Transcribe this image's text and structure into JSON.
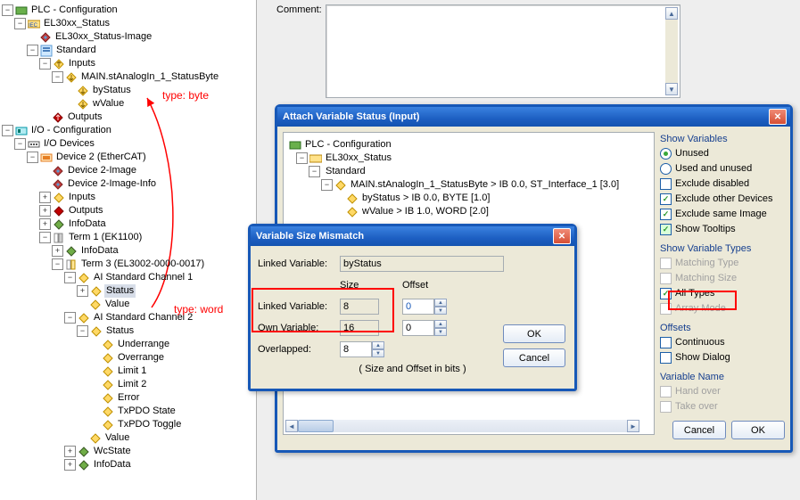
{
  "left_tree": {
    "plc_config": "PLC - Configuration",
    "el30xx_status": "EL30xx_Status",
    "el30xx_status_image": "EL30xx_Status-Image",
    "standard": "Standard",
    "inputs": "Inputs",
    "main_statusbyte": "MAIN.stAnalogIn_1_StatusByte",
    "bystatus": "byStatus",
    "wvalue": "wValue",
    "outputs": "Outputs",
    "io_config": "I/O - Configuration",
    "io_devices": "I/O Devices",
    "device2": "Device 2 (EtherCAT)",
    "device2_image": "Device 2-Image",
    "device2_image_info": "Device 2-Image-Info",
    "inputs2": "Inputs",
    "outputs2": "Outputs",
    "infodata": "InfoData",
    "term1": "Term 1 (EK1100)",
    "infodata2": "InfoData",
    "term3": "Term 3 (EL3002-0000-0017)",
    "ai_ch1": "AI Standard Channel 1",
    "status": "Status",
    "value": "Value",
    "ai_ch2": "AI Standard Channel 2",
    "status2": "Status",
    "underrange": "Underrange",
    "overrange": "Overrange",
    "limit1": "Limit 1",
    "limit2": "Limit 2",
    "error": "Error",
    "txpdo_state": "TxPDO State",
    "txpdo_toggle": "TxPDO Toggle",
    "value2": "Value",
    "wcstate": "WcState",
    "infodata3": "InfoData"
  },
  "comment_label": "Comment:",
  "attach": {
    "title": "Attach Variable Status (Input)",
    "tree": {
      "plc": "PLC - Configuration",
      "el30xx": "EL30xx_Status",
      "standard": "Standard",
      "main": "MAIN.stAnalogIn_1_StatusByte   >   IB 0.0, ST_Interface_1 [3.0]",
      "bystatus": "byStatus   >   IB 0.0, BYTE [1.0]",
      "wvalue": "wValue   >   IB 1.0, WORD [2.0]"
    },
    "groups": {
      "show_vars": "Show Variables",
      "unused": "Unused",
      "used_unused": "Used and unused",
      "exclude_disabled": "Exclude disabled",
      "exclude_other": "Exclude other Devices",
      "exclude_same": "Exclude same Image",
      "tooltips": "Show Tooltips",
      "show_types": "Show Variable Types",
      "match_type": "Matching Type",
      "match_size": "Matching Size",
      "all_types": "All Types",
      "array_mode": "Array Mode",
      "offsets": "Offsets",
      "continuous": "Continuous",
      "show_dialog": "Show Dialog",
      "var_name": "Variable Name",
      "hand_over": "Hand over",
      "take_over": "Take over"
    },
    "buttons": {
      "cancel": "Cancel",
      "ok": "OK"
    }
  },
  "mismatch": {
    "title": "Variable Size Mismatch",
    "linked_var_lbl": "Linked Variable:",
    "linked_var_val": "byStatus",
    "size_hdr": "Size",
    "offset_hdr": "Offset",
    "linked_var_row": "Linked Variable:",
    "linked_size": "8",
    "linked_offset": "0",
    "own_var_row": "Own Variable:",
    "own_size": "16",
    "own_offset": "0",
    "overlapped_row": "Overlapped:",
    "overlapped_val": "8",
    "note": "( Size and Offset in bits )",
    "ok": "OK",
    "cancel": "Cancel"
  },
  "annotations": {
    "type_byte": "type: byte",
    "type_word": "type: word"
  }
}
